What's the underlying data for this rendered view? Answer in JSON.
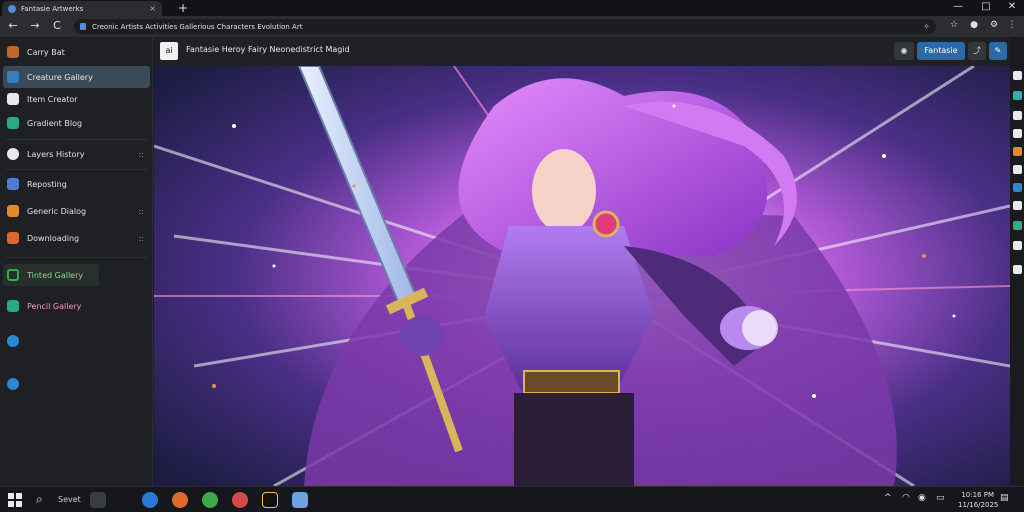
{
  "browser": {
    "tab_title": "Fantasie Artwerks",
    "new_tab": "+",
    "close_tab": "×",
    "url": "Creonic Artists Activities Gallerious Characters Evolution Art",
    "window_controls": {
      "minimize": "—",
      "maximize": "□",
      "close": "✕"
    },
    "nav": {
      "back": "←",
      "forward": "→",
      "reload": "C"
    }
  },
  "sidebar": {
    "items": [
      {
        "label": "Carry Bat",
        "icon_color": "#c0662c"
      },
      {
        "label": "Creature Gallery",
        "icon_color": "#3a7fc2",
        "active": true
      },
      {
        "label": "Item Creator",
        "icon_color": "#e9e9e9"
      },
      {
        "label": "Gradient Blog",
        "icon_color": "#2aa88a"
      },
      {
        "label": "Layers History",
        "icon_color": "#e9e9e9",
        "more": "::"
      },
      {
        "label": "Reposting",
        "icon_color": "#4f7ad6"
      },
      {
        "label": "Generic Dialog",
        "icon_color": "#e08a2c",
        "more": "::"
      },
      {
        "label": "Downloading",
        "icon_color": "#e0662c",
        "more": "::"
      },
      {
        "label": "Tinted Gallery",
        "icon_color": "#2fb04f"
      },
      {
        "label": "Pencil Gallery",
        "icon_color": "#2aa88a"
      },
      {
        "label": "",
        "icon_color": "#2b86d6"
      },
      {
        "label": "",
        "icon_color": "#2b86d6"
      }
    ]
  },
  "header": {
    "logo_text": "ai",
    "title": "Fantasie Heroy Fairy Neonedistrict Magid",
    "btn_eye": "◉",
    "btn_primary": "Fantasie",
    "btn_share": "⤴",
    "btn_edit": "✎"
  },
  "artwork": {
    "description_alt": "Purple-haired armored warrior with sword and cape"
  },
  "taskbar": {
    "search_label": "Sevet",
    "clock_time": "10:16 PM",
    "clock_date": "11/16/2025",
    "tray_up": "^",
    "colors": [
      "#2b78d4",
      "#e06a2a",
      "#3ea84a",
      "#d44a4a",
      "#111111",
      "#6aa2e0"
    ]
  }
}
